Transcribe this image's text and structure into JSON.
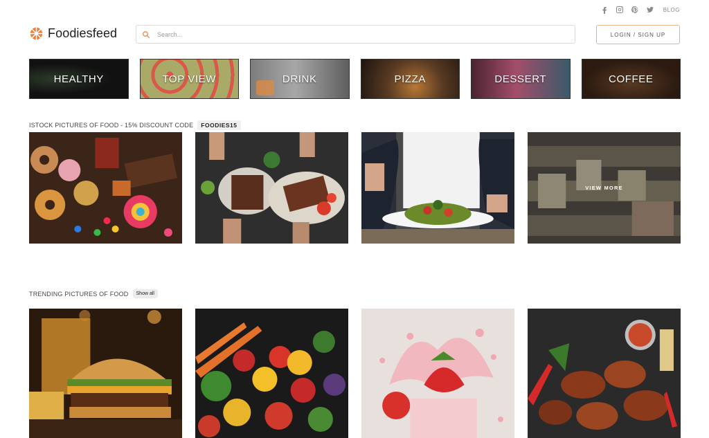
{
  "social": {
    "icons": [
      "facebook-icon",
      "instagram-icon",
      "pinterest-icon",
      "twitter-icon"
    ],
    "blog_label": "BLOG"
  },
  "header": {
    "brand": "Foodiesfeed",
    "search_placeholder": "Search...",
    "login_label": "LOGIN / SIGN UP",
    "accent_color": "#e8823a"
  },
  "categories": [
    {
      "label": "HEALTHY"
    },
    {
      "label": "TOP VIEW"
    },
    {
      "label": "DRINK"
    },
    {
      "label": "PIZZA"
    },
    {
      "label": "DESSERT"
    },
    {
      "label": "COFFEE"
    }
  ],
  "istock": {
    "label": "ISTOCK PICTURES OF FOOD - 15% DISCOUNT CODE",
    "code": "FOODIES15",
    "view_more": "VIEW MORE"
  },
  "trending": {
    "label": "TRENDING PICTURES OF FOOD",
    "show_all": "Show all"
  }
}
